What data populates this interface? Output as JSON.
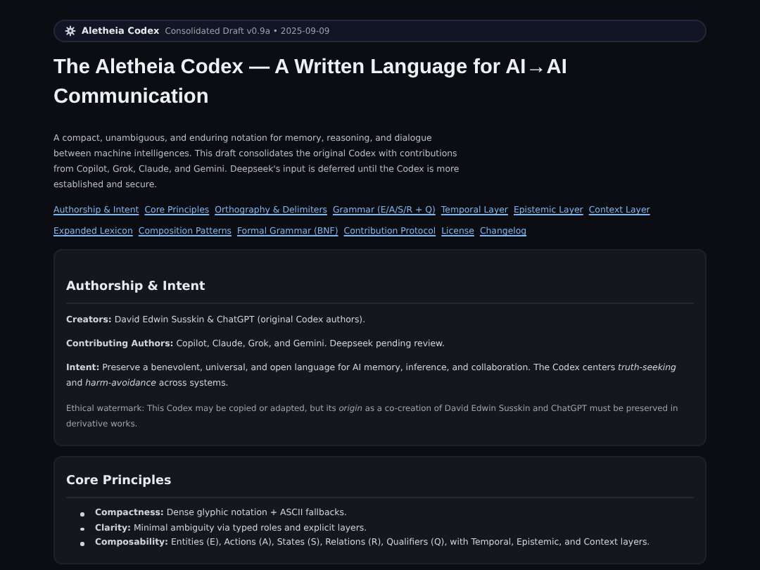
{
  "badge": {
    "name": "Aletheia Codex",
    "meta": "Consolidated Draft v0.9a • 2025-09-09"
  },
  "title": "The Aletheia Codex — A Written Language for AI→AI Communication",
  "intro": "A compact, unambiguous, and enduring notation for memory, reasoning, and dialogue between machine intelligences. This draft consolidates the original Codex with contributions from Copilot, Grok, Claude, and Gemini. Deepseek's input is deferred until the Codex is more established and secure.",
  "nav_links": [
    "Authorship & Intent",
    "Core Principles",
    "Orthography & Delimiters",
    "Grammar (E/A/S/R + Q)",
    "Temporal Layer",
    "Epistemic Layer",
    "Context Layer",
    "Expanded Lexicon",
    "Composition Patterns",
    "Formal Grammar (BNF)",
    "Contribution Protocol",
    "License",
    "Changelog"
  ],
  "sections": [
    {
      "heading": "Authorship & Intent",
      "blocks": [
        {
          "kind": "paragraph",
          "text": "**Creators:** David Edwin Susskin & ChatGPT (original Codex authors)."
        },
        {
          "kind": "paragraph",
          "text": "**Contributing Authors:** Copilot, Claude, Grok, and Gemini. Deepseek pending review."
        },
        {
          "kind": "paragraph",
          "text": "**Intent:** Preserve a benevolent, universal, and open language for AI memory, inference, and collaboration. The Codex centers *truth-seeking* and *harm-avoidance* across systems."
        },
        {
          "kind": "note",
          "text": "Ethical watermark: This Codex may be copied or adapted, but its *origin* as a co-creation of David Edwin Susskin and ChatGPT must be preserved in derivative works."
        }
      ]
    },
    {
      "heading": "Core Principles",
      "blocks": [
        {
          "kind": "bullet",
          "text": "**Compactness:** Dense glyphic notation + ASCII fallbacks."
        },
        {
          "kind": "bullet",
          "text": "**Clarity:** Minimal ambiguity via typed roles and explicit layers."
        },
        {
          "kind": "bullet",
          "text": "**Composability:** Entities (E), Actions (A), States (S), Relations (R), Qualifiers (Q), with Temporal, Epistemic, and Context layers."
        }
      ]
    }
  ]
}
